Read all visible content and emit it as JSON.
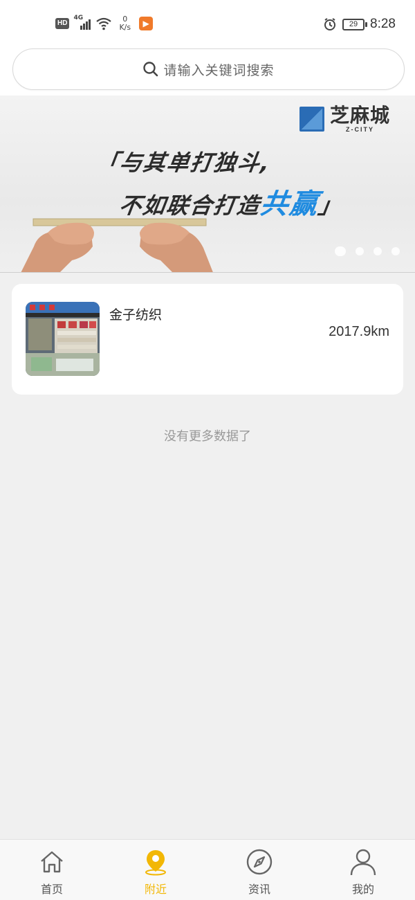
{
  "status_bar": {
    "hd": "HD",
    "network": "4G",
    "speed_value": "0",
    "speed_unit": "K/s",
    "battery": "29",
    "time": "8:28"
  },
  "search": {
    "placeholder": "请输入关键词搜索"
  },
  "banner": {
    "brand_cn": "芝麻城",
    "brand_en": "Z-CITY",
    "slogan_line1": "「与其单打独斗,",
    "slogan_line2_prefix": "不如联合打造",
    "slogan_line2_accent": "共赢",
    "slogan_line2_suffix": "」",
    "accent_color": "#1f8be0",
    "slide_count": 4,
    "active_slide": 1
  },
  "stores": [
    {
      "name": "金子纺织",
      "distance": "2017.9km"
    }
  ],
  "list_footer": "没有更多数据了",
  "tabbar": {
    "active_color": "#f2b705",
    "items": [
      {
        "label": "首页",
        "icon": "home-icon"
      },
      {
        "label": "附近",
        "icon": "location-pin-icon",
        "active": true
      },
      {
        "label": "资讯",
        "icon": "compass-icon"
      },
      {
        "label": "我的",
        "icon": "user-icon"
      }
    ]
  }
}
